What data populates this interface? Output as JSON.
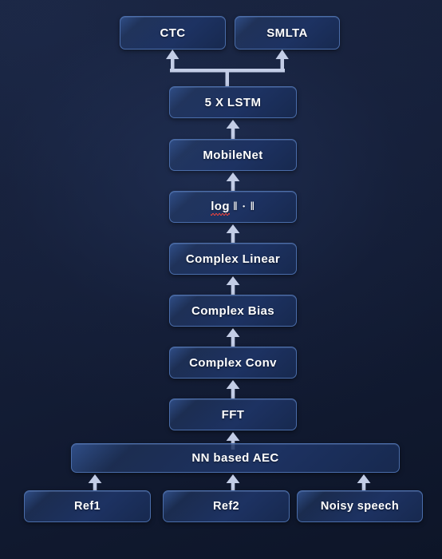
{
  "diagram": {
    "title": "Speech recognition front-end pipeline block diagram",
    "background_color": "#16203a",
    "node_border_color": "#4a6daa",
    "node_fill_top_color": "#2f4d86",
    "node_fill_bottom_color": "#17294f",
    "arrow_color": "#c3cde6",
    "text_color": "#ffffff",
    "spellcheck_underline_color": "#d9413f"
  },
  "nodes": {
    "ctc": "CTC",
    "smlta": "SMLTA",
    "lstm": "5 X LSTM",
    "mobilenet": "MobileNet",
    "log_norm_prefix": "log",
    "log_norm_suffix": "‖ · ‖",
    "complex_linear": "Complex Linear",
    "complex_bias": "Complex Bias",
    "complex_conv": "Complex Conv",
    "fft": "FFT",
    "aec": "NN based AEC",
    "ref1": "Ref1",
    "ref2": "Ref2",
    "noisy_speech": "Noisy speech"
  },
  "flow": {
    "edges": [
      "Ref1 -> NN based AEC",
      "Ref2 -> NN based AEC",
      "Noisy speech -> NN based AEC",
      "NN based AEC -> FFT",
      "FFT -> Complex Conv",
      "Complex Conv -> Complex Bias",
      "Complex Bias -> Complex Linear",
      "Complex Linear -> log ‖ · ‖",
      "log ‖ · ‖ -> MobileNet",
      "MobileNet -> 5 X LSTM",
      "5 X LSTM -> CTC",
      "5 X LSTM -> SMLTA"
    ]
  }
}
